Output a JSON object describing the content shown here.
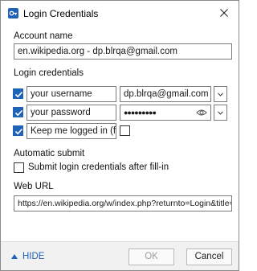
{
  "window": {
    "title": "Login Credentials"
  },
  "account": {
    "section_label": "Account name",
    "value": "en.wikipedia.org - dp.blrqa@gmail.com"
  },
  "credentials": {
    "section_label": "Login credentials",
    "username": {
      "checked": true,
      "label_value": "your username",
      "value": "dp.blrqa@gmail.com"
    },
    "password": {
      "checked": true,
      "label_value": "your password",
      "value": "●●●●●●●●●"
    },
    "keep_logged_in": {
      "checked": true,
      "label_value": "Keep me logged in (for u",
      "value_checked": false
    }
  },
  "auto_submit": {
    "section_label": "Automatic submit",
    "checkbox_label": "Submit login credentials after fill-in",
    "checked": false
  },
  "web_url": {
    "section_label": "Web URL",
    "value": "https://en.wikipedia.org/w/index.php?returnto=Login&title=S"
  },
  "footer": {
    "hide_label": "HIDE",
    "ok_label": "OK",
    "cancel_label": "Cancel"
  },
  "colors": {
    "accent": "#1f63b8",
    "footer_bg": "#f1f1f1"
  },
  "icons": {
    "app": "key-shield-icon",
    "close": "close-icon",
    "dropdown": "chevron-down-icon",
    "reveal": "eye-icon",
    "hide": "triangle-up-icon"
  }
}
